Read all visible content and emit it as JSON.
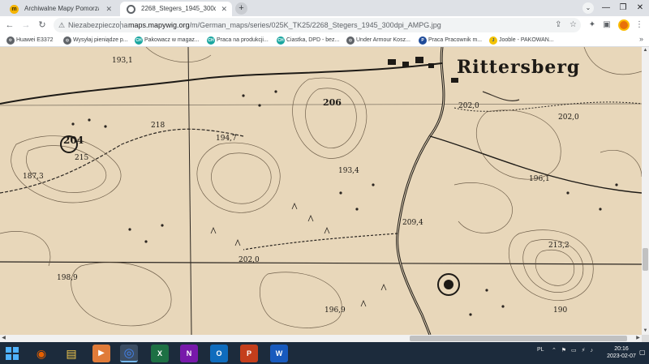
{
  "tabs": [
    {
      "title": "Archiwalne Mapy Pomorza Gdańsk",
      "favicon": "m",
      "active": false
    },
    {
      "title": "2268_Stegers_1945_300dpi_AMPG",
      "favicon": "",
      "active": true
    }
  ],
  "tab_close_glyph": "✕",
  "new_tab_glyph": "+",
  "window_controls": {
    "tab_search": "⌄",
    "minimize": "—",
    "maximize": "❐",
    "close": "✕"
  },
  "toolbar": {
    "back": "←",
    "forward": "→",
    "reload": "↻",
    "security_warning": "⚠",
    "security_text": "Niezabezpieczona",
    "url_host": "maps.mapywig.org",
    "url_path": "/m/German_maps/series/025K_TK25/2268_Stegers_1945_300dpi_AMPG.jpg",
    "share": "⇪",
    "star": "☆",
    "extensions": "✦",
    "side_panel": "▣",
    "menu": "⋮"
  },
  "bookmarks": [
    {
      "label": "Huawei E3372",
      "icon": "gear-icon",
      "color": "#5f6368",
      "glyph": "⚙"
    },
    {
      "label": "Wysyłaj pieniądze p...",
      "icon": "globe-icon",
      "color": "#5f6368",
      "glyph": "◍"
    },
    {
      "label": "Pakowacz w magaz...",
      "icon": "site-icon",
      "color": "#1aa6a0",
      "glyph": "CH"
    },
    {
      "label": "Praca na produkcji...",
      "icon": "site-icon",
      "color": "#1aa6a0",
      "glyph": "CH"
    },
    {
      "label": "Ciastka, DPD - bez...",
      "icon": "site-icon",
      "color": "#1aa6a0",
      "glyph": "CH"
    },
    {
      "label": "Under Armour Kosz...",
      "icon": "globe-icon",
      "color": "#5f6368",
      "glyph": "◍"
    },
    {
      "label": "Praca Pracownik m...",
      "icon": "site-icon",
      "color": "#1f4b99",
      "glyph": "P"
    },
    {
      "label": "Jooble - PAKOWAN...",
      "icon": "flag-icon",
      "color": "#f2c200",
      "glyph": "J"
    }
  ],
  "bookmarks_more": "»",
  "map_labels": {
    "town": "Rittersberg",
    "spot_heights": [
      "193,1",
      "204",
      "215",
      "187,3",
      "194,7",
      "206",
      "193,4",
      "209,4",
      "202,0",
      "196,1",
      "213,2",
      "198,9",
      "202,0",
      "218",
      "202,0",
      "196,9",
      "190"
    ]
  },
  "scrollbar": {
    "up": "▲",
    "down": "▼",
    "left": "◀",
    "right": "▶"
  },
  "taskbar": {
    "apps": [
      {
        "name": "firefox",
        "glyph": "◉",
        "color": "#e66000"
      },
      {
        "name": "file-explorer",
        "glyph": "▤",
        "color": "#f2c94c"
      },
      {
        "name": "media-player",
        "glyph": "▶",
        "color": "#e07b39"
      },
      {
        "name": "chrome",
        "glyph": "◎",
        "color": "#4285f4"
      },
      {
        "name": "excel",
        "glyph": "X",
        "color": "#1d7044"
      },
      {
        "name": "onenote",
        "glyph": "N",
        "color": "#7719aa"
      },
      {
        "name": "outlook",
        "glyph": "O",
        "color": "#0f6cbd"
      },
      {
        "name": "powerpoint",
        "glyph": "P",
        "color": "#c43e1c"
      },
      {
        "name": "word",
        "glyph": "W",
        "color": "#185abd"
      }
    ],
    "language": "PL",
    "tray_icons": "⌃ ⚑ ▭ ⚡ ♪",
    "time": "20:16",
    "date": "2023-02-07",
    "notifications": "▢"
  }
}
